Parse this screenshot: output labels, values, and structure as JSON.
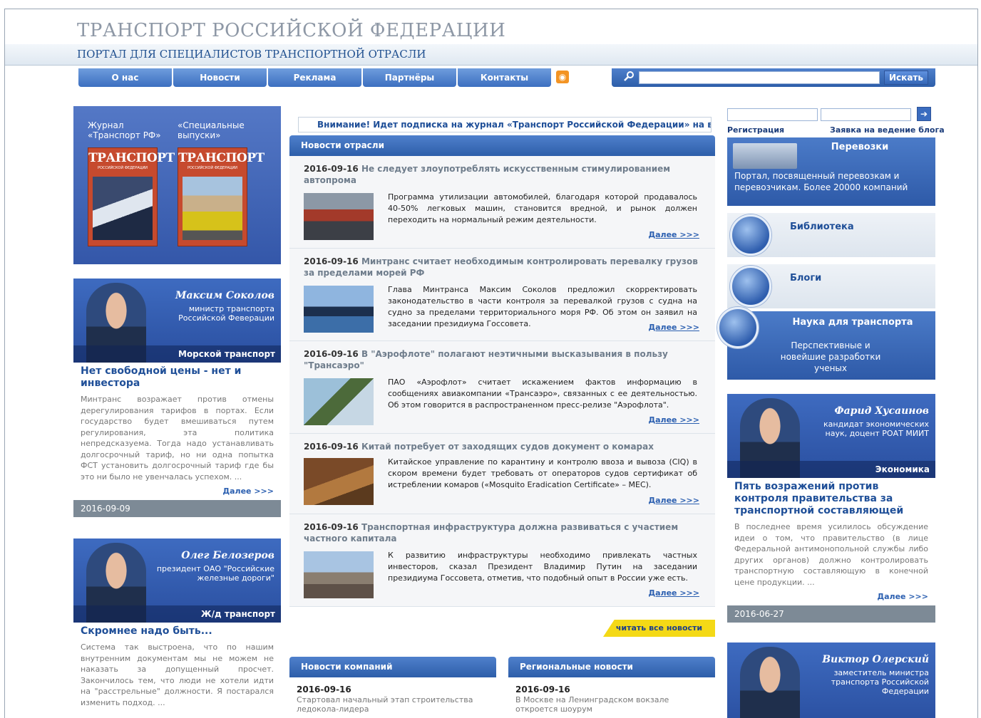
{
  "header": {
    "title": "ТРАНСПОРТ РОССИЙСКОЙ ФЕДЕРАЦИИ",
    "subtitle": "ПОРТАЛ ДЛЯ СПЕЦИАЛИСТОВ ТРАНСПОРТНОЙ ОТРАСЛИ"
  },
  "nav": {
    "items": [
      "О нас",
      "Новости",
      "Реклама",
      "Партнёры",
      "Контакты"
    ],
    "rss_icon": "rss-icon"
  },
  "search": {
    "button": "Искать",
    "value": ""
  },
  "journals": {
    "left_caption": "Журнал\n«Транспорт РФ»",
    "right_caption": "«Специальные\nвыпуски»",
    "cover_title": "ТРАНСПОРТ",
    "cover_sub": "РОССИЙСКОЙ ФЕДЕРАЦИИ"
  },
  "left_cards": [
    {
      "name": "Максим Соколов",
      "role": "министр транспорта Российской Феверации",
      "rubric": "Морской транспорт",
      "headline": "Нет свободной цены - нет и инвестора",
      "text": "Минтранс возражает против отмены дерегулирования тарифов в портах. Если государство будет вмешиваться путем регулирования, эта политика непредсказуема. Тогда надо устанавливать долгосрочный тариф, но ни одна попытка ФСТ установить долгосрочный тариф где бы это ни было не увенчалась успехом. ...",
      "more": "Далее >>>",
      "date": "2016-09-09"
    },
    {
      "name": "Олег Белозеров",
      "role": "президент ОАО \"Российские железные дороги\"",
      "rubric": "Ж/д транспорт",
      "headline": "Скромнее надо быть...",
      "text": "Система так выстроена, что по нашим внутренним документам мы не можем не наказать за допущенный просчет. Закончилось тем, что люди не хотели идти на \"расстрельные\" должности. Я постарался изменить подход. ..."
    }
  ],
  "notice": "Внимание! Идет подписка на журнал «Транспорт Российской Федерации» на вторі",
  "news": {
    "header": "Новости отрасли",
    "items": [
      {
        "date": "2016-09-16",
        "title": " Не следует злоупотреблять искусственным стимулированием автопрома",
        "text": "Программа утилизации автомобилей, благодаря которой продавалось 40-50% легковых машин, становится вредной, и рынок должен переходить на нормальный режим деятельности.",
        "more": "Далее >>>"
      },
      {
        "date": "2016-09-16",
        "title": " Минтранс считает необходимым контролировать перевалку грузов за пределами морей РФ",
        "text": "Глава Минтранса Максим Соколов предложил скорректировать законодательство в части контроля за перевалкой грузов с судна на судно за пределами территориального моря РФ. Об этом он заявил на заседании президиума Госсовета.",
        "more": "Далее >>>"
      },
      {
        "date": "2016-09-16",
        "title": " В \"Аэрофлоте\" полагают неэтичными высказывания в пользу \"Трансаэро\"",
        "text": "ПАО «Аэрофлот» считает искажением фактов информацию в сообщениях авиакомпании «Трансаэро», связанных с ее деятельностью. Об этом говорится в распространенном пресс-релизе \"Аэрофлота\".",
        "more": "Далее >>>"
      },
      {
        "date": "2016-09-16",
        "title": " Китай потребует от заходящих судов документ о комарах",
        "text": "Китайское управление по карантину и контролю ввоза и вывоза (CIQ) в скором времени будет требовать от операторов судов сертификат об истреблении комаров («Mosquito Eradication Certificate» – MEC).",
        "more": "Далее >>>"
      },
      {
        "date": "2016-09-16",
        "title": " Транспортная инфраструктура должна развиваться с участием частного капитала",
        "text": "К развитию инфраструктуры необходимо привлекать частных инвесторов, сказал Президент Владимир Путин на заседании президиума Госсовета, отметив, что подобный опыт в России уже есть.",
        "more": "Далее >>>"
      }
    ],
    "read_all": "читать все новости"
  },
  "company_news": {
    "header": "Новости компаний",
    "date": "2016-09-16",
    "text": "Стартовал начальный этап строительства ледокола-лидера"
  },
  "regional_news": {
    "header": "Региональные новости",
    "date": "2016-09-16",
    "text": "В Москве на Ленинградском вокзале откроется шоурум"
  },
  "login": {
    "register": "Регистрация",
    "blog_request": "Заявка на ведение блога"
  },
  "right_blocks": {
    "transport": {
      "title": "Перевозки",
      "text": "Портал, посвященный перевозкам и перевозчикам. Более 20000 компаний"
    },
    "library": "Библиотека",
    "blogs": "Блоги",
    "science": {
      "title": "Наука для транспорта",
      "text": "Перспективные и новейшие разработки ученых"
    }
  },
  "right_cards": [
    {
      "name": "Фарид Хусаинов",
      "role": "кандидат экономических наук, доцент РОАТ МИИТ",
      "rubric": "Экономика",
      "headline": "Пять возражений против контроля правительства за транспортной составляющей",
      "text": "В последнее время усилилось обсуждение идеи о том, что правительство (в лице Федеральной антимонопольной службы либо других органов) должно контролировать транспортную составляющую в конечной цене продукции. ...",
      "more": "Далее >>>",
      "date": "2016-06-27"
    },
    {
      "name": "Виктор Олерский",
      "role": "заместитель министра транспорта Российской Федерации"
    }
  ],
  "colors": {
    "accent_blue": "#3c6fc0",
    "title_gray": "#8e98a6",
    "subtitle_blue": "#1f4f8f",
    "read_all_yellow": "#f4d916"
  }
}
